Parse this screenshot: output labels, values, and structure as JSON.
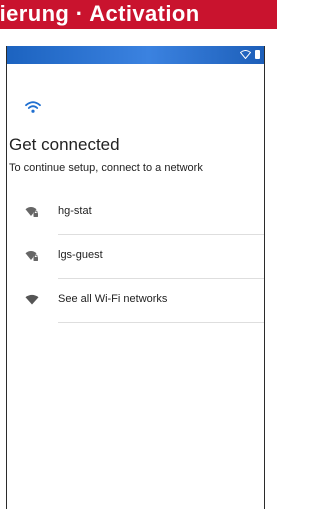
{
  "banner": {
    "text": "vierung · Activation"
  },
  "statusbar": {
    "wifi_icon": "wifi-outline-icon",
    "battery_icon": "battery-icon"
  },
  "setup": {
    "header_icon": "wifi-icon",
    "title": "Get connected",
    "subtitle": "To continue setup, connect to a network"
  },
  "networks": [
    {
      "name": "hg-stat",
      "icon": "wifi-locked-icon",
      "secured": true
    },
    {
      "name": "lgs-guest",
      "icon": "wifi-locked-icon",
      "secured": true
    },
    {
      "name": "See all Wi-Fi networks",
      "icon": "wifi-full-icon",
      "secured": false
    }
  ],
  "colors": {
    "banner": "#c9132e",
    "statusbar": "#2a72d6",
    "accent": "#1f6fd0",
    "text": "#222222",
    "icon": "#555555"
  }
}
